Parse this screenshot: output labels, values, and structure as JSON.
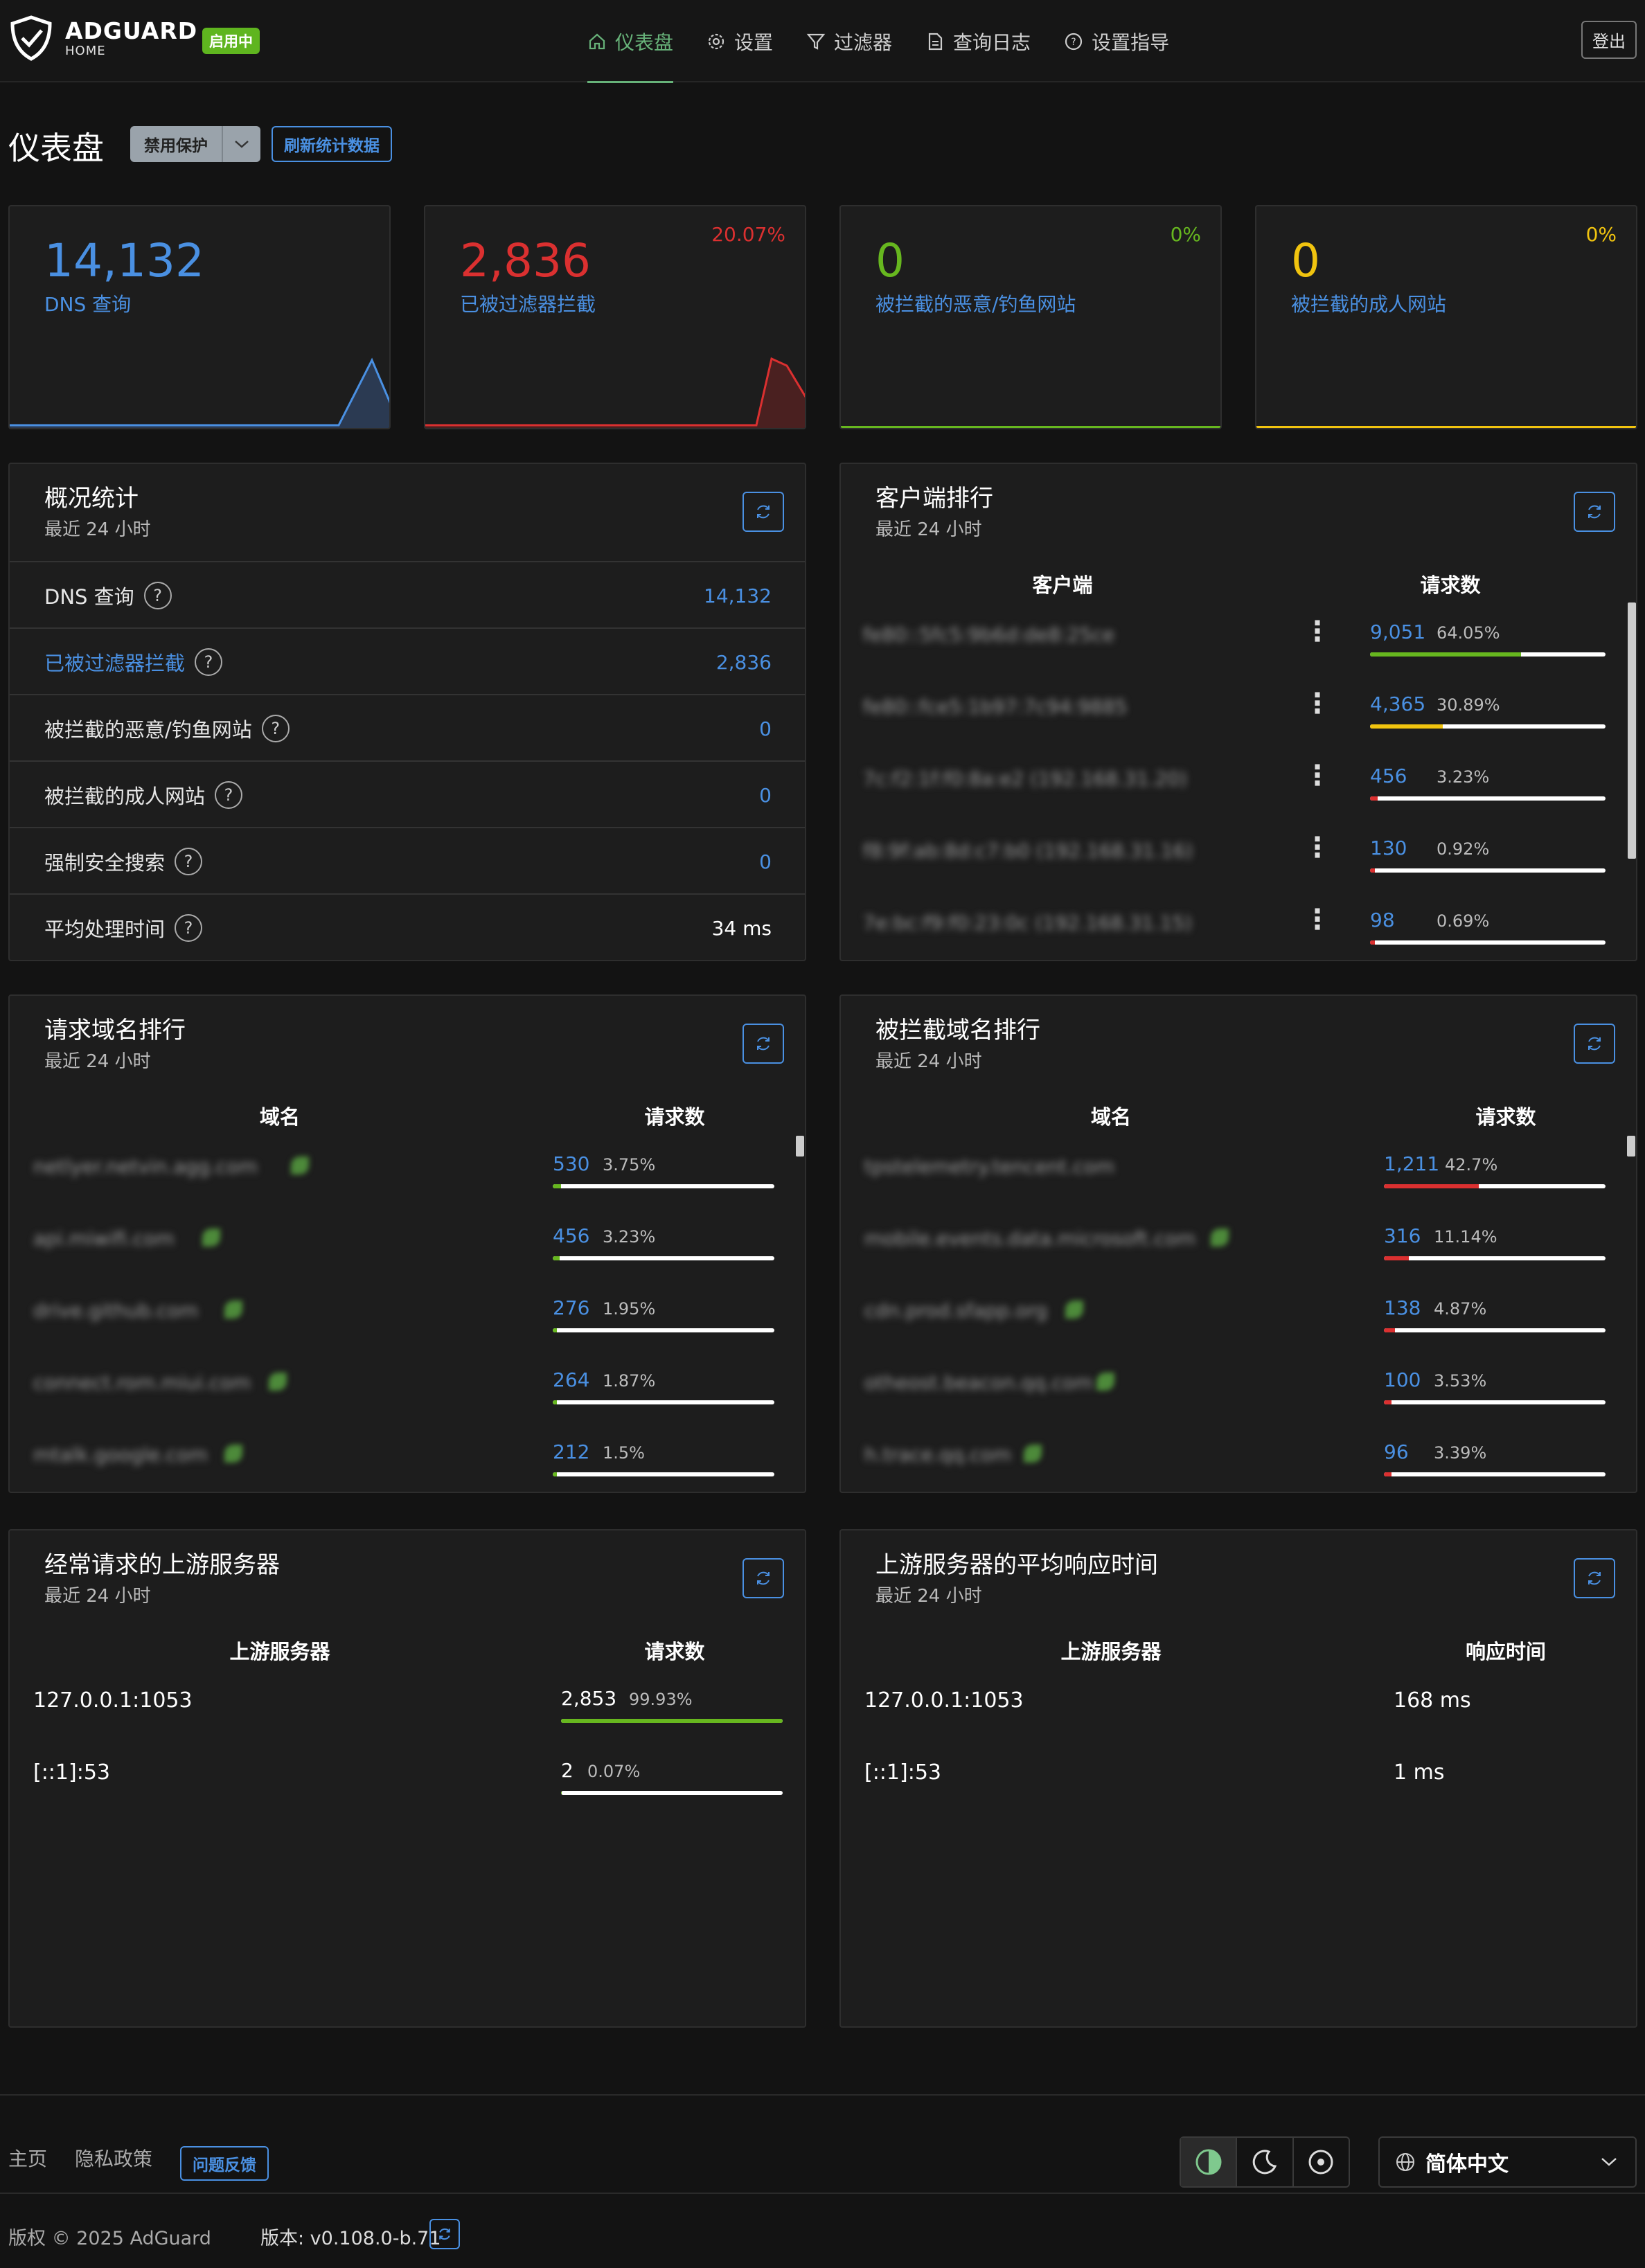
{
  "header": {
    "logo_main": "ADGUARD",
    "logo_sub": "HOME",
    "status_badge": "启用中",
    "nav": [
      {
        "label": "仪表盘",
        "icon": "home-icon",
        "active": true
      },
      {
        "label": "设置",
        "icon": "gear-icon"
      },
      {
        "label": "过滤器",
        "icon": "filter-icon"
      },
      {
        "label": "查询日志",
        "icon": "document-icon"
      },
      {
        "label": "设置指导",
        "icon": "help-icon"
      }
    ],
    "logout": "登出"
  },
  "page": {
    "title": "仪表盘",
    "disable_protection": "禁用保护",
    "refresh_stats": "刷新统计数据"
  },
  "stat_cards": [
    {
      "value": "14,132",
      "label": "DNS 查询",
      "percent": "",
      "color": "#4a90e2"
    },
    {
      "value": "2,836",
      "label": "已被过滤器拦截",
      "percent": "20.07%",
      "color": "#db3030"
    },
    {
      "value": "0",
      "label": "被拦截的恶意/钓鱼网站",
      "percent": "0%",
      "color": "#67b71f"
    },
    {
      "value": "0",
      "label": "被拦截的成人网站",
      "percent": "0%",
      "color": "#f1c40f"
    }
  ],
  "overview": {
    "title": "概况统计",
    "subtitle": "最近 24 小时",
    "rows": [
      {
        "label": "DNS 查询",
        "value": "14,132"
      },
      {
        "label": "已被过滤器拦截",
        "value": "2,836"
      },
      {
        "label": "被拦截的恶意/钓鱼网站",
        "value": "0"
      },
      {
        "label": "被拦截的成人网站",
        "value": "0"
      },
      {
        "label": "强制安全搜索",
        "value": "0"
      },
      {
        "label": "平均处理时间",
        "value": "34 ms"
      }
    ]
  },
  "clients": {
    "title": "客户端排行",
    "subtitle": "最近 24 小时",
    "col_client": "客户端",
    "col_requests": "请求数",
    "rows": [
      {
        "name": "fe80::5fc5:9b6d:de8:25ce",
        "count": "9,051",
        "percent": "64.05%",
        "fill": 0.64,
        "color": "#67b71f"
      },
      {
        "name": "fe80::fce5:1b97:7c94:9885",
        "count": "4,365",
        "percent": "30.89%",
        "fill": 0.31,
        "color": "#f1c40f"
      },
      {
        "name": "7c:f2:1f:f0:8a:e2 (192.168.31.20)",
        "count": "456",
        "percent": "3.23%",
        "fill": 0.032,
        "color": "#db3030"
      },
      {
        "name": "f8:9f:ab:8d:c7:b0 (192.168.31.16)",
        "count": "130",
        "percent": "0.92%",
        "fill": 0.01,
        "color": "#db3030"
      },
      {
        "name": "7e:bc:f9:f0:23:0c (192.168.31.15)",
        "count": "98",
        "percent": "0.69%",
        "fill": 0.007,
        "color": "#db3030"
      }
    ]
  },
  "queried_domains": {
    "title": "请求域名排行",
    "subtitle": "最近 24 小时",
    "col_domain": "域名",
    "col_requests": "请求数",
    "rows": [
      {
        "name": "netlyer.netvin.agg.com",
        "count": "530",
        "percent": "3.75%",
        "fill": 0.038
      },
      {
        "name": "api.miwifi.com",
        "count": "456",
        "percent": "3.23%",
        "fill": 0.032
      },
      {
        "name": "drive.github.com",
        "count": "276",
        "percent": "1.95%",
        "fill": 0.02
      },
      {
        "name": "connect.rom.miui.com",
        "count": "264",
        "percent": "1.87%",
        "fill": 0.019
      },
      {
        "name": "mtalk.google.com",
        "count": "212",
        "percent": "1.5%",
        "fill": 0.015
      }
    ]
  },
  "blocked_domains": {
    "title": "被拦截域名排行",
    "subtitle": "最近 24 小时",
    "col_domain": "域名",
    "col_requests": "请求数",
    "rows": [
      {
        "name": "tpstelemetry.tencent.com",
        "count": "1,211",
        "percent": "42.7%",
        "fill": 0.427
      },
      {
        "name": "mobile.events.data.microsoft.com",
        "count": "316",
        "percent": "11.14%",
        "fill": 0.111
      },
      {
        "name": "cdn.prod.sfapp.org",
        "count": "138",
        "percent": "4.87%",
        "fill": 0.049
      },
      {
        "name": "otheost.beacon.qq.com",
        "count": "100",
        "percent": "3.53%",
        "fill": 0.035
      },
      {
        "name": "h.trace.qq.com",
        "count": "96",
        "percent": "3.39%",
        "fill": 0.034
      }
    ]
  },
  "upstreams": {
    "title": "经常请求的上游服务器",
    "subtitle": "最近 24 小时",
    "col_server": "上游服务器",
    "col_requests": "请求数",
    "rows": [
      {
        "name": "127.0.0.1:1053",
        "count": "2,853",
        "percent": "99.93%",
        "fill": 0.999
      },
      {
        "name": "[::1]:53",
        "count": "2",
        "percent": "0.07%",
        "fill": 0.001
      }
    ]
  },
  "upstream_time": {
    "title": "上游服务器的平均响应时间",
    "subtitle": "最近 24 小时",
    "col_server": "上游服务器",
    "col_time": "响应时间",
    "rows": [
      {
        "name": "127.0.0.1:1053",
        "time": "168 ms"
      },
      {
        "name": "[::1]:53",
        "time": "1 ms"
      }
    ]
  },
  "footer": {
    "home": "主页",
    "privacy": "隐私政策",
    "feedback": "问题反馈",
    "language": "简体中文",
    "copyright": "版权 © 2025 AdGuard",
    "version": "版本: v0.108.0-b.71"
  }
}
